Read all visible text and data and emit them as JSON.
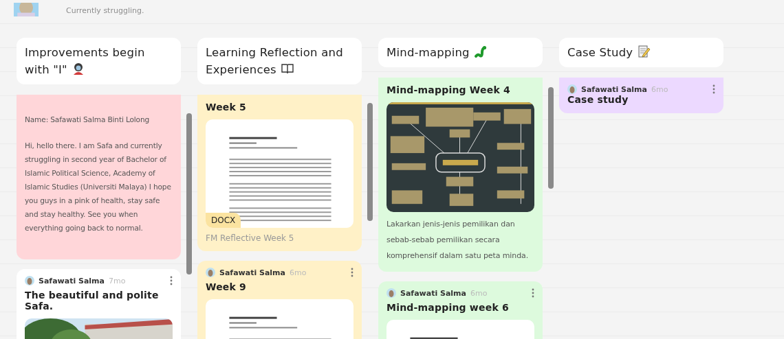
{
  "profile": {
    "status": "Currently struggling."
  },
  "columns": [
    {
      "title": "Improvements begin with \"I\"",
      "posts": [
        {
          "color": "#ffd6d9",
          "paragraphs": [
            "Name: Safawati Salma Binti Lolong",
            "Hi, hello there. I am Safa and currently struggling in second year of Bachelor of Islamic Political Science, Academy of Islamic Studies (Universiti Malaya) I hope you guys in a pink of health, stay safe and stay healthy. See you when everything going back to normal."
          ]
        },
        {
          "color": "#ffffff",
          "author": "Safawati Salma",
          "time": "7mo",
          "title": "The beautiful and polite Safa."
        }
      ]
    },
    {
      "title": "Learning Reflection and Experiences",
      "posts": [
        {
          "color": "#fff1c7",
          "title": "Week 5",
          "attachment": {
            "kind": "document",
            "badge": "DOCX"
          },
          "caption": "FM Reflective Week 5"
        },
        {
          "color": "#fff1c7",
          "author": "Safawati Salma",
          "time": "6mo",
          "title": "Week 9",
          "attachment": {
            "kind": "document"
          }
        }
      ]
    },
    {
      "title": "Mind-mapping",
      "posts": [
        {
          "color": "#ddfadd",
          "title": "Mind-mapping Week 4",
          "attachment": {
            "kind": "mindmap"
          },
          "body": "Lakarkan jenis-jenis pemilikan dan sebab-sebab pemilikan secara komprehensif dalam satu peta minda."
        },
        {
          "color": "#ddfadd",
          "author": "Safawati Salma",
          "time": "6mo",
          "title": "Mind-mapping week 6",
          "attachment": {
            "kind": "document"
          }
        }
      ]
    },
    {
      "title": "Case Study",
      "posts": [
        {
          "color": "#ecd9ff",
          "author": "Safawati Salma",
          "time": "6mo",
          "title": "Case study"
        }
      ]
    }
  ]
}
